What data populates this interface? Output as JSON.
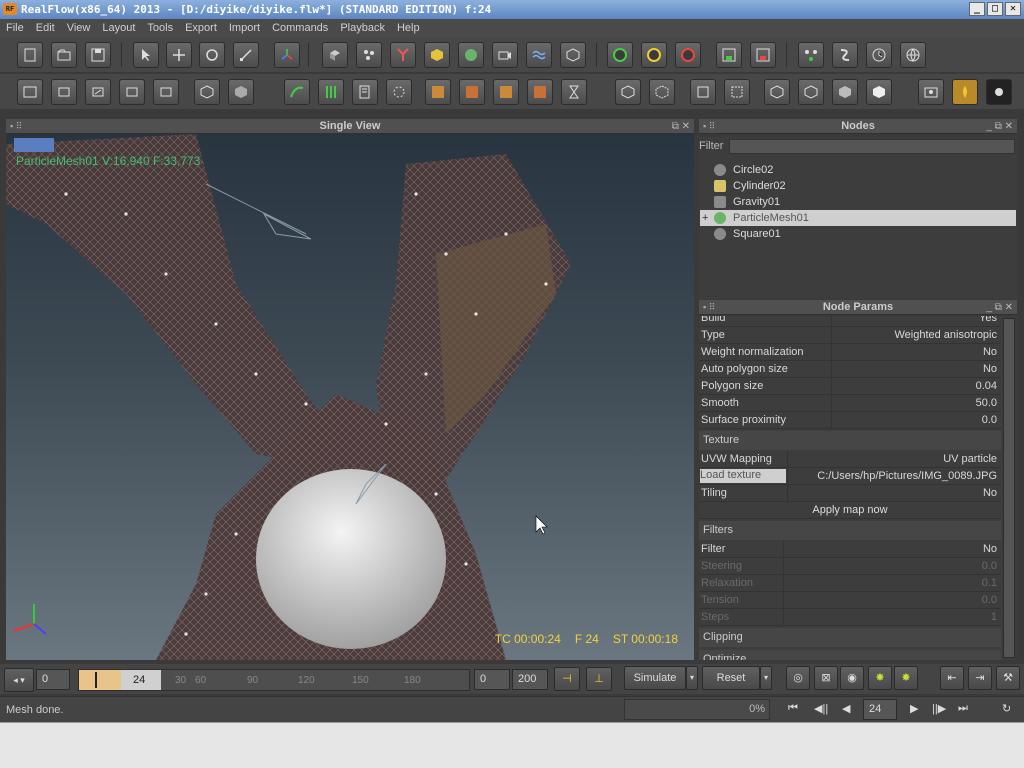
{
  "window": {
    "app_title": "RealFlow(x86_64) 2013 - [D:/diyike/diyike.flw*] (STANDARD EDITION) f:24",
    "app_icon_text": "RF",
    "controls": [
      "_",
      "□",
      "✕"
    ]
  },
  "menu": [
    "File",
    "Edit",
    "View",
    "Layout",
    "Tools",
    "Export",
    "Import",
    "Commands",
    "Playback",
    "Help"
  ],
  "viewport": {
    "title": "Single View",
    "object_label": "ParticleMesh01 V:16,940 F:33,773",
    "tc": "TC 00:00:24",
    "frame": "F 24",
    "st": "ST 00:00:18"
  },
  "nodes_panel": {
    "title": "Nodes",
    "filter_label": "Filter",
    "filter_value": "",
    "items": [
      {
        "label": "Circle02",
        "icon": "emitter-icon",
        "color": "#8a8a8a",
        "selected": false
      },
      {
        "label": "Cylinder02",
        "icon": "object-icon",
        "color": "#d8c26a",
        "selected": false
      },
      {
        "label": "Gravity01",
        "icon": "daemon-icon",
        "color": "#8a8a8a",
        "selected": false
      },
      {
        "label": "ParticleMesh01",
        "icon": "mesh-icon",
        "color": "#6ab36a",
        "selected": true
      },
      {
        "label": "Square01",
        "icon": "emitter-icon",
        "color": "#8a8a8a",
        "selected": false
      }
    ]
  },
  "params_panel": {
    "title": "Node Params",
    "rows": [
      {
        "k": "Build",
        "v": "Yes"
      },
      {
        "k": "Type",
        "v": "Weighted anisotropic"
      },
      {
        "k": "Weight normalization",
        "v": "No"
      },
      {
        "k": "Auto polygon size",
        "v": "No"
      },
      {
        "k": "Polygon size",
        "v": "0.04"
      },
      {
        "k": "Smooth",
        "v": "50.0"
      },
      {
        "k": "Surface proximity",
        "v": "0.0"
      }
    ],
    "texture_section": "Texture",
    "texture_rows": [
      {
        "k": "UVW Mapping",
        "v": "UV particle"
      },
      {
        "k": "Load texture",
        "v": "C:/Users/hp/Pictures/IMG_0089.JPG"
      },
      {
        "k": "Tiling",
        "v": "No"
      }
    ],
    "apply_map": "Apply map now",
    "filters_section": "Filters",
    "filter_rows": [
      {
        "k": "Filter",
        "v": "No"
      },
      {
        "k": "Steering",
        "v": "0.0"
      },
      {
        "k": "Relaxation",
        "v": "0.1"
      },
      {
        "k": "Tension",
        "v": "0.0"
      },
      {
        "k": "Steps",
        "v": "1"
      }
    ],
    "clipping_section": "Clipping",
    "optimize_section": "Optimize"
  },
  "timeline": {
    "start": "0",
    "current": "24",
    "ticks": [
      "30",
      "60",
      "90",
      "120",
      "150",
      "180"
    ],
    "range_start": "0",
    "range_end": "200",
    "simulate": "Simulate",
    "reset": "Reset",
    "frame_field": "24"
  },
  "status": {
    "message": "Mesh done.",
    "progress": "0%"
  }
}
